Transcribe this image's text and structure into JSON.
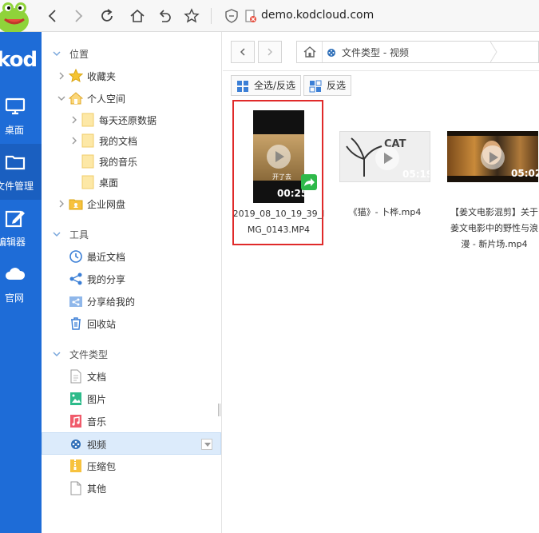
{
  "browser": {
    "url": "demo.kodcloud.com"
  },
  "rail": {
    "logo": "kod",
    "items": [
      {
        "label": "桌面"
      },
      {
        "label": "文件管理"
      },
      {
        "label": "编辑器"
      },
      {
        "label": "官网"
      }
    ]
  },
  "sidebar": {
    "location_header": "位置",
    "favorites": "收藏夹",
    "personal_space": "个人空间",
    "personal_children": [
      "每天还原数据",
      "我的文档",
      "我的音乐",
      "桌面"
    ],
    "enterprise": "企业网盘",
    "tools_header": "工具",
    "tools": [
      "最近文档",
      "我的分享",
      "分享给我的",
      "回收站"
    ],
    "types_header": "文件类型",
    "types": [
      "文档",
      "图片",
      "音乐",
      "视频",
      "压缩包",
      "其他"
    ],
    "selected_type": "视频"
  },
  "main": {
    "breadcrumb": "文件类型 - 视频",
    "select_all": "全选/反选",
    "invert": "反选",
    "files": [
      {
        "name": "2019_08_10_19_39_IMG_0143.MP4",
        "duration": "00:25",
        "caption": "开了去"
      },
      {
        "name": "《猫》- 卜桦.mp4",
        "duration": "05:19",
        "caption": "CAT"
      },
      {
        "name": "【姜文电影混剪】关于姜文电影中的野性与浪漫 - 新片场.mp4",
        "duration": "05:02"
      }
    ]
  },
  "colors": {
    "rail": "#1e6cd7",
    "highlight": "#e02a2a",
    "share": "#2fb94a"
  }
}
